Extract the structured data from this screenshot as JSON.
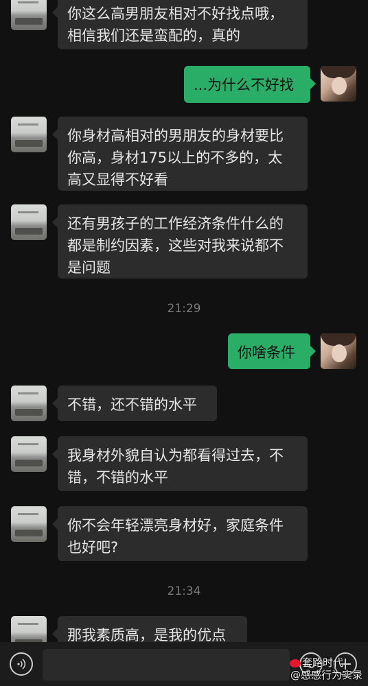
{
  "messages": [
    {
      "side": "left",
      "text": "你这么高男朋友相对不好找点哦，\n相信我们还是蛮配的，真的"
    },
    {
      "side": "right",
      "text": "...为什么不好找"
    },
    {
      "side": "left",
      "text": "你身材高相对的男朋友的身材要比\n你高，身材175以上的不多的，太\n高又显得不好看"
    },
    {
      "side": "left",
      "text": "还有男孩子的工作经济条件什么的\n都是制约因素，这些对我来说都不\n是问题"
    },
    {
      "time": "21:29"
    },
    {
      "side": "right",
      "text": "你啥条件"
    },
    {
      "side": "left",
      "text": "不错，还不错的水平"
    },
    {
      "side": "left",
      "text": "我身材外貌自认为都看得过去，不\n错，不错的水平"
    },
    {
      "side": "left",
      "text": "你不会年轻漂亮身材好，家庭条件\n也好吧?"
    },
    {
      "time": "21:34"
    },
    {
      "side": "left",
      "text": "那我素质高，是我的优点"
    }
  ],
  "icons": {
    "voice": "voice-icon",
    "emoji": "emoji-icon",
    "plus": "plus-icon"
  },
  "input": {
    "value": ""
  },
  "watermark": {
    "line1": "套路时代",
    "line2": "@感感行为实录"
  },
  "colors": {
    "background": "#111111",
    "bubble_left": "#2c2c2c",
    "bubble_right": "#2aae67",
    "time_text": "#7a7a7a"
  }
}
